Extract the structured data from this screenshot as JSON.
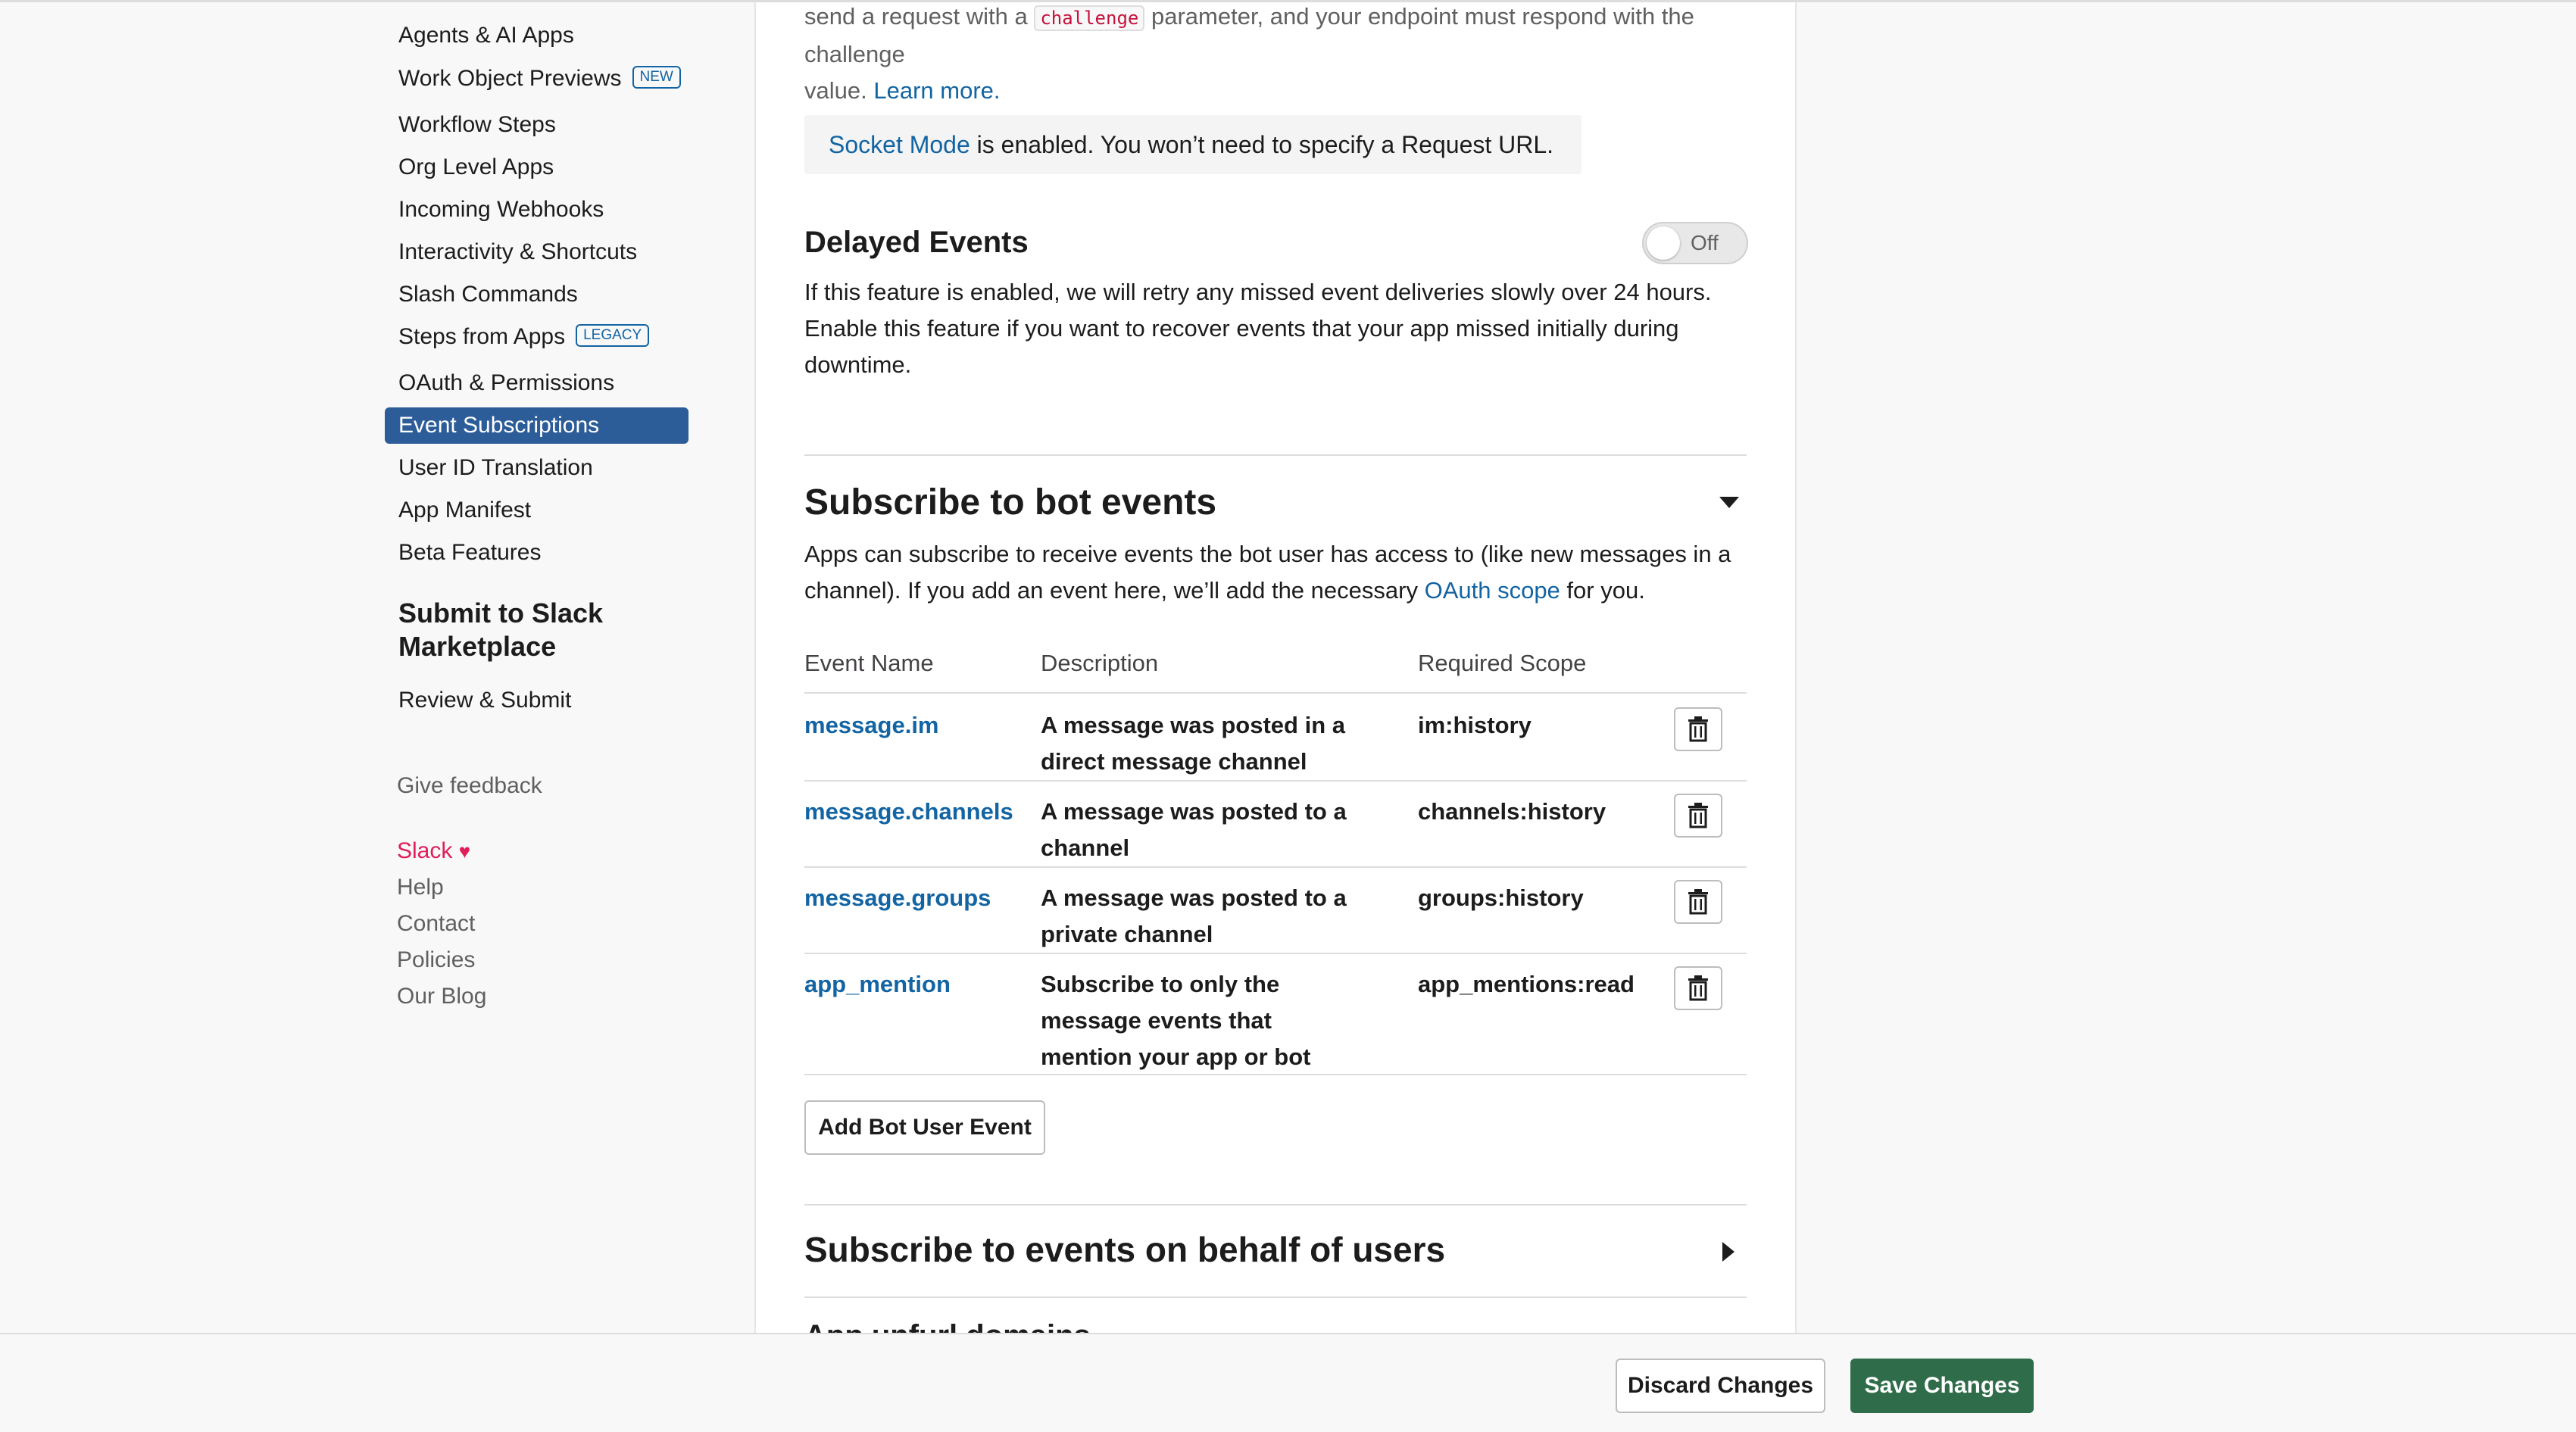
{
  "sidebar": {
    "items": [
      {
        "label": "Agents & AI Apps",
        "badge": ""
      },
      {
        "label": "Work Object Previews",
        "badge": "NEW"
      },
      {
        "label": "Workflow Steps",
        "badge": ""
      },
      {
        "label": "Org Level Apps",
        "badge": ""
      },
      {
        "label": "Incoming Webhooks",
        "badge": ""
      },
      {
        "label": "Interactivity & Shortcuts",
        "badge": ""
      },
      {
        "label": "Slash Commands",
        "badge": ""
      },
      {
        "label": "Steps from Apps",
        "badge": "LEGACY"
      },
      {
        "label": "OAuth & Permissions",
        "badge": ""
      },
      {
        "label": "Event Subscriptions",
        "badge": "",
        "active": true
      },
      {
        "label": "User ID Translation",
        "badge": ""
      },
      {
        "label": "App Manifest",
        "badge": ""
      },
      {
        "label": "Beta Features",
        "badge": ""
      }
    ],
    "submit_heading": "Submit to Slack Marketplace",
    "review_submit": "Review & Submit",
    "give_feedback": "Give feedback",
    "footer_links": {
      "slack": "Slack",
      "heart": "♥",
      "help": "Help",
      "contact": "Contact",
      "policies": "Policies",
      "blog": "Our Blog"
    }
  },
  "main": {
    "intro": {
      "line1_before": "send a request with a",
      "code": "challenge",
      "line1_after": "parameter, and your endpoint must respond with the challenge",
      "line2": "value.",
      "learn_more": "Learn more."
    },
    "socket_notice": {
      "link": "Socket Mode",
      "text": "is enabled. You won’t need to specify a Request URL."
    },
    "delayed_events": {
      "title": "Delayed Events",
      "toggle_label": "Off",
      "description": "If this feature is enabled, we will retry any missed event deliveries slowly over 24 hours. Enable this feature if you want to recover events that your app missed initially during downtime."
    },
    "bot_events": {
      "title": "Subscribe to bot events",
      "description_before": "Apps can subscribe to receive events the bot user has access to (like new messages in a channel). If you add an event here, we’ll add the necessary",
      "oauth_link": "OAuth scope",
      "description_after": "for you.",
      "columns": [
        "Event Name",
        "Description",
        "Required Scope"
      ],
      "rows": [
        {
          "name": "message.im",
          "description": "A message was posted in a direct message channel",
          "scope": "im:history"
        },
        {
          "name": "message.channels",
          "description": "A message was posted to a channel",
          "scope": "channels:history"
        },
        {
          "name": "message.groups",
          "description": "A message was posted to a private channel",
          "scope": "groups:history"
        },
        {
          "name": "app_mention",
          "description": "Subscribe to only the message events that mention your app or bot",
          "scope": "app_mentions:read"
        }
      ],
      "add_button": "Add Bot User Event"
    },
    "user_events": {
      "title": "Subscribe to events on behalf of users"
    },
    "next_section_partial": "App unfurl domains"
  },
  "footer": {
    "discard": "Discard Changes",
    "save": "Save Changes"
  },
  "icons": {
    "trash": "trash-icon",
    "expand": "caret-down-icon",
    "collapse": "caret-right-icon"
  },
  "colors": {
    "accent": "#1264a3",
    "active_nav": "#2c5d99",
    "save": "#2f6c4a",
    "code": "#c4123c",
    "slack": "#e01e5a"
  }
}
